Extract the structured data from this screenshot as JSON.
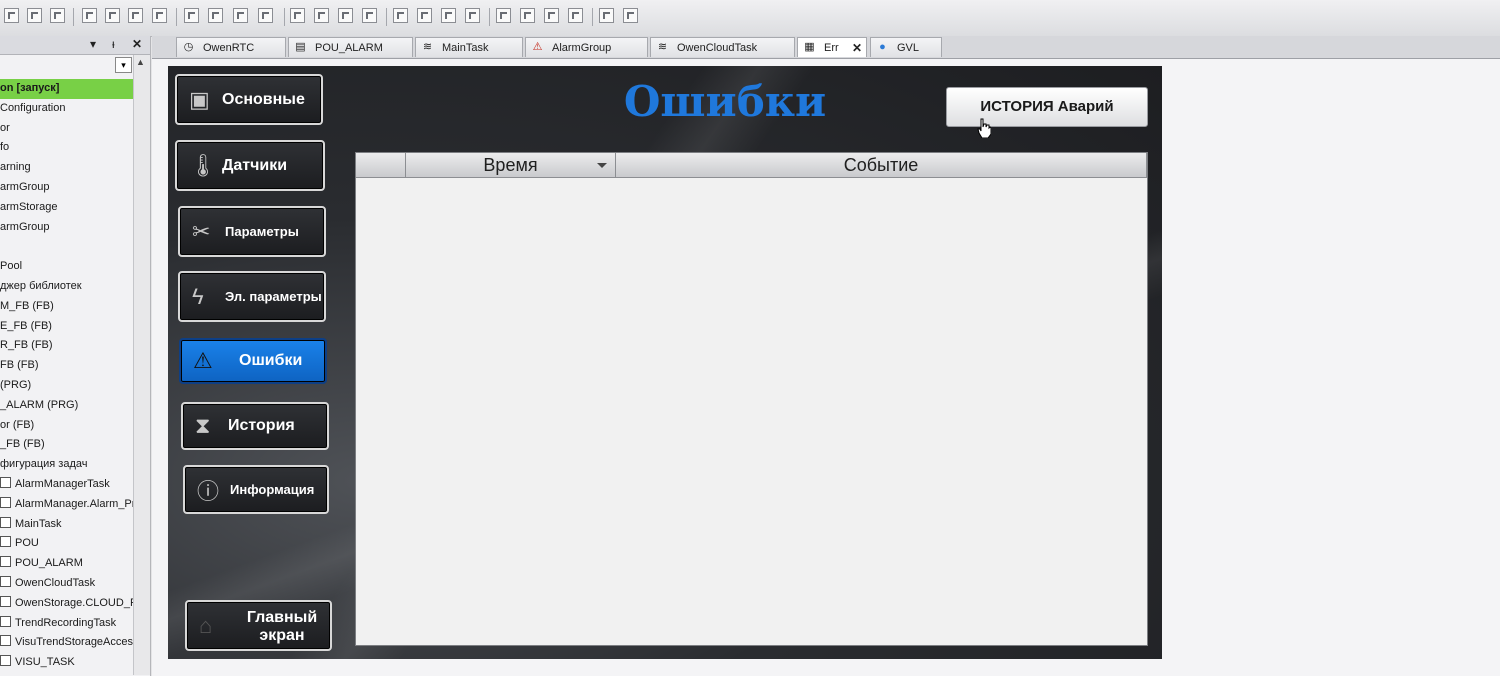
{
  "left_panel": {
    "tree": [
      {
        "label": "on [запуск]",
        "selected": true
      },
      {
        "label": "Configuration"
      },
      {
        "label": "or"
      },
      {
        "label": "fo"
      },
      {
        "label": "arning"
      },
      {
        "label": "armGroup"
      },
      {
        "label": "armStorage"
      },
      {
        "label": "armGroup"
      },
      {
        "label": ""
      },
      {
        "label": "Pool"
      },
      {
        "label": "джер библиотек"
      },
      {
        "label": "M_FB (FB)"
      },
      {
        "label": "E_FB (FB)"
      },
      {
        "label": "R_FB (FB)"
      },
      {
        "label": "FB (FB)"
      },
      {
        "label": "(PRG)"
      },
      {
        "label": "_ALARM (PRG)"
      },
      {
        "label": "or (FB)"
      },
      {
        "label": "_FB (FB)"
      },
      {
        "label": "фигурация задач"
      },
      {
        "label": "AlarmManagerTask"
      },
      {
        "label": "AlarmManager.Alarm_Prg"
      },
      {
        "label": "MainTask"
      },
      {
        "label": "POU"
      },
      {
        "label": "POU_ALARM"
      },
      {
        "label": "OwenCloudTask"
      },
      {
        "label": "OwenStorage.CLOUD_PR"
      },
      {
        "label": "TrendRecordingTask"
      },
      {
        "label": "VisuTrendStorageAccess"
      },
      {
        "label": "VISU_TASK"
      }
    ]
  },
  "tabs": [
    {
      "label": "OwenRTC",
      "icon": "clock-icon"
    },
    {
      "label": "POU_ALARM",
      "icon": "pou-icon"
    },
    {
      "label": "MainTask",
      "icon": "task-icon"
    },
    {
      "label": "AlarmGroup",
      "icon": "warning-icon"
    },
    {
      "label": "OwenCloudTask",
      "icon": "task-icon"
    },
    {
      "label": "Err",
      "icon": "visu-icon",
      "active": true
    },
    {
      "label": "GVL",
      "icon": "globe-icon"
    }
  ],
  "visu": {
    "title": "Ошибки",
    "nav": [
      {
        "label": "Основные",
        "icon": "book-icon"
      },
      {
        "label": "Датчики",
        "icon": "thermometer-icon"
      },
      {
        "label": "Параметры",
        "icon": "tools-icon"
      },
      {
        "label": "Эл. параметры",
        "icon": "lightning-icon"
      },
      {
        "label": "Ошибки",
        "icon": "warning-icon",
        "active": true
      },
      {
        "label": "История",
        "icon": "hourglass-icon"
      },
      {
        "label": "Информация",
        "icon": "info-icon"
      }
    ],
    "home_button": {
      "line1": "Главный",
      "line2": "экран",
      "icon": "home-icon"
    },
    "history_button": "ИСТОРИЯ Аварий",
    "table": {
      "columns": [
        "",
        "Время",
        "Событие"
      ],
      "sort_column": "Время",
      "rows": []
    }
  }
}
